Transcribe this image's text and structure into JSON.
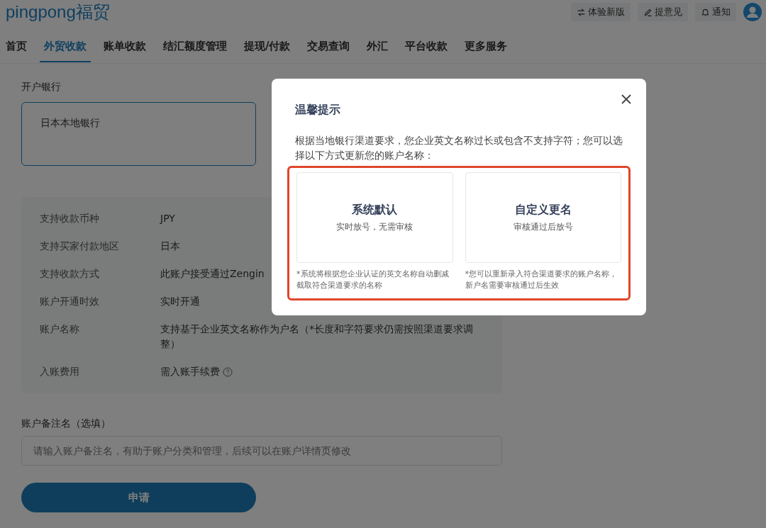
{
  "header": {
    "logo": "pingpong福贸",
    "actions": [
      {
        "kind": "switch",
        "label": "体验新版"
      },
      {
        "kind": "feedback",
        "label": "提意见"
      },
      {
        "kind": "notice",
        "label": "通知"
      }
    ]
  },
  "tabs": [
    {
      "label": "首页",
      "selected": false
    },
    {
      "label": "外贸收款",
      "selected": true
    },
    {
      "label": "账单收款",
      "selected": false
    },
    {
      "label": "结汇额度管理",
      "selected": false
    },
    {
      "label": "提现/付款",
      "selected": false
    },
    {
      "label": "交易查询",
      "selected": false
    },
    {
      "label": "外汇",
      "selected": false
    },
    {
      "label": "平台收款",
      "selected": false
    },
    {
      "label": "更多服务",
      "selected": false
    }
  ],
  "form": {
    "bank_label": "开户银行",
    "banks": [
      {
        "label": "日本本地银行",
        "selected": true
      }
    ],
    "info": [
      {
        "label": "支持收款币种",
        "value": "JPY"
      },
      {
        "label": "支持买家付款地区",
        "value": "日本"
      },
      {
        "label": "支持收款方式",
        "value": "此账户接受通过Zengin"
      },
      {
        "label": "账户开通时效",
        "value": "实时开通"
      },
      {
        "label": "账户名称",
        "value": "支持基于企业英文名称作为户名（*长度和字符要求仍需按照渠道要求调整）"
      },
      {
        "label": "入账费用",
        "value": "需入账手续费",
        "help": true
      }
    ],
    "remark_label": "账户备注名（选填）",
    "remark_placeholder": "请输入账户备注名，有助于账户分类和管理，后续可以在账户详情页修改",
    "submit": "申请"
  },
  "dialog": {
    "title": "温馨提示",
    "message": "根据当地银行渠道要求，您企业英文名称过长或包含不支持字符；您可以选择以下方式更新您的账户名称：",
    "highlighted": true,
    "options": [
      {
        "title": "系统默认",
        "subtitle": "实时放号，无需审核",
        "note": "*系统将根据您企业认证的英文名称自动删减截取符合渠道要求的名称"
      },
      {
        "title": "自定义更名",
        "subtitle": "审核通过后放号",
        "note": "*您可以重新录入符合渠道要求的账户名称，新户名需要审核通过后生效"
      }
    ]
  }
}
